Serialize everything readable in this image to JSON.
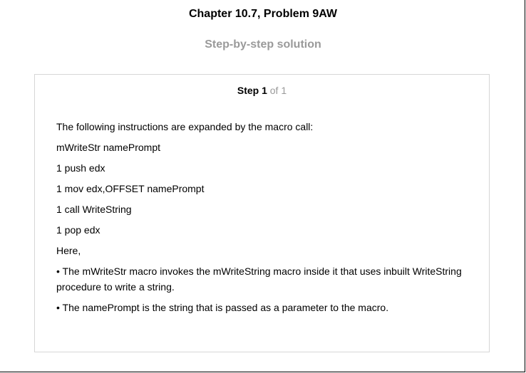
{
  "header": {
    "chapter_title": "Chapter 10.7, Problem 9AW",
    "solution_heading": "Step-by-step solution"
  },
  "step": {
    "label": "Step 1",
    "of_text": "of 1"
  },
  "content": {
    "intro": "The following instructions are expanded by the macro call:",
    "macro_call": "mWriteStr namePrompt",
    "code_lines": [
      "1 push edx",
      "1 mov edx,OFFSET namePrompt",
      "1 call WriteString",
      "1 pop edx"
    ],
    "here": "Here,",
    "bullets": [
      "• The mWriteStr macro invokes the mWriteString macro inside it that uses inbuilt WriteString procedure to write a string.",
      "• The namePrompt is the string that is passed as a parameter to the macro."
    ]
  }
}
